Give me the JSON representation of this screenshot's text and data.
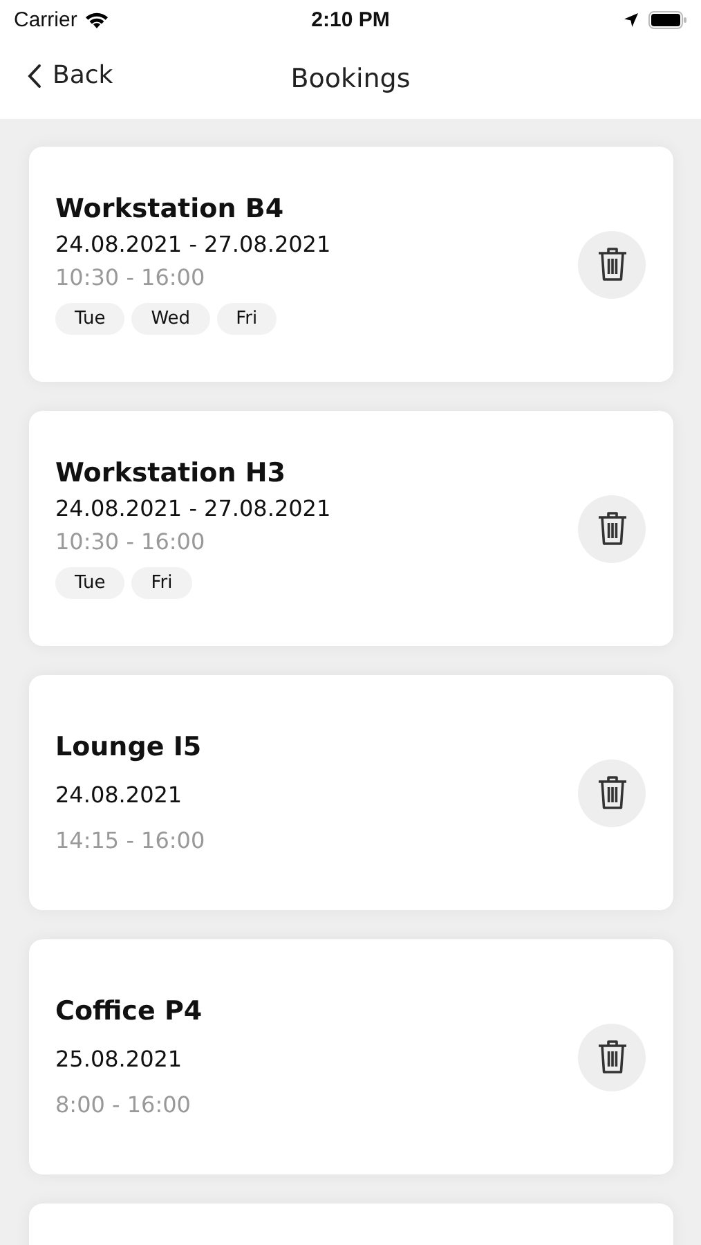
{
  "status_bar": {
    "carrier": "Carrier",
    "time": "2:10 PM"
  },
  "nav": {
    "back": "Back",
    "title": "Bookings"
  },
  "bookings": [
    {
      "name": "Workstation B4",
      "dates": "24.08.2021 - 27.08.2021",
      "time": "10:30 - 16:00",
      "days": [
        "Tue",
        "Wed",
        "Fri"
      ]
    },
    {
      "name": "Workstation H3",
      "dates": "24.08.2021 - 27.08.2021",
      "time": "10:30 - 16:00",
      "days": [
        "Tue",
        "Fri"
      ]
    },
    {
      "name": "Lounge I5",
      "dates": "24.08.2021",
      "time": "14:15 - 16:00"
    },
    {
      "name": "Coffice P4",
      "dates": "25.08.2021",
      "time": "8:00 - 16:00"
    }
  ]
}
